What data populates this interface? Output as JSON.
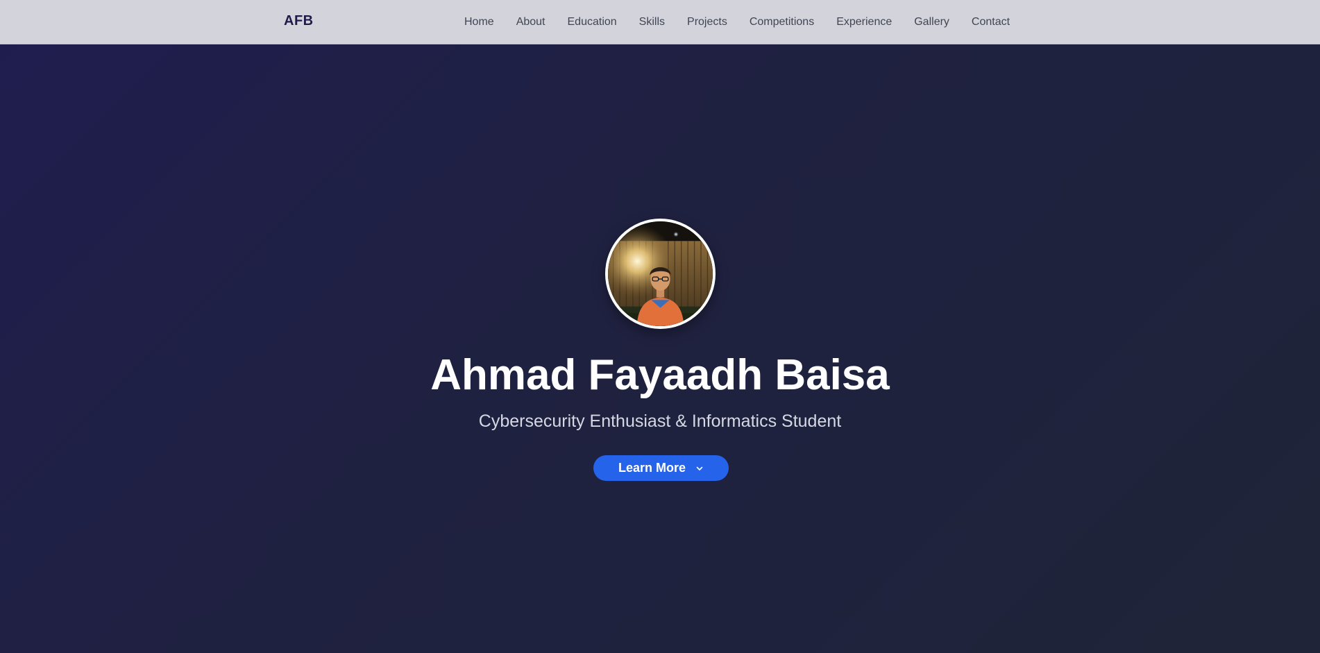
{
  "nav": {
    "brand": "AFB",
    "links": [
      {
        "label": "Home"
      },
      {
        "label": "About"
      },
      {
        "label": "Education"
      },
      {
        "label": "Skills"
      },
      {
        "label": "Projects"
      },
      {
        "label": "Competitions"
      },
      {
        "label": "Experience"
      },
      {
        "label": "Gallery"
      },
      {
        "label": "Contact"
      }
    ]
  },
  "hero": {
    "name": "Ahmad Fayaadh Baisa",
    "subtitle": "Cybersecurity Enthusiast & Informatics Student",
    "cta_label": "Learn More",
    "cta_icon": "chevron-down-icon",
    "avatar_icon": "profile-photo"
  },
  "colors": {
    "nav_background": "#d3d3dc",
    "brand_text": "#1e1b4b",
    "hero_background": "#1f2140",
    "cta_background": "#2563eb",
    "name_text": "#ffffff"
  }
}
